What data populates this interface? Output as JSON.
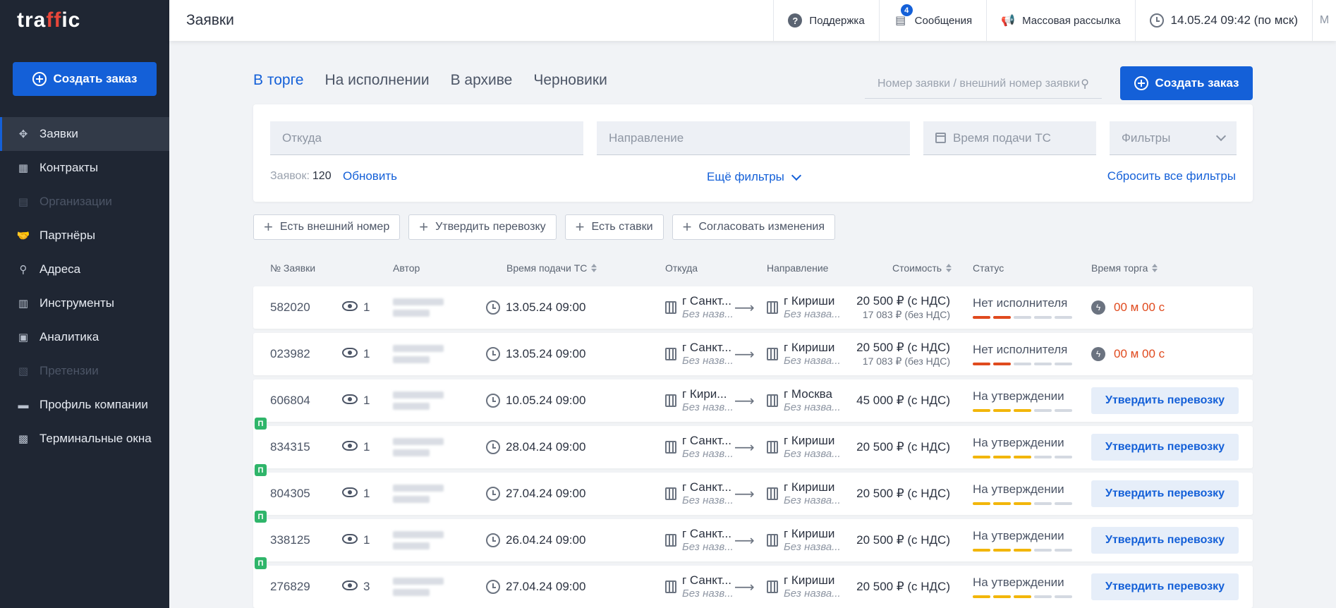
{
  "app": {
    "logo": "traffic"
  },
  "sidebar": {
    "create_label": "Создать заказ",
    "items": [
      {
        "label": "Заявки",
        "icon": "move-icon",
        "glyph": "✥",
        "active": true,
        "disabled": false
      },
      {
        "label": "Контракты",
        "icon": "calendar-icon",
        "glyph": "▦",
        "active": false,
        "disabled": false
      },
      {
        "label": "Организации",
        "icon": "building-icon",
        "glyph": "▤",
        "active": false,
        "disabled": true
      },
      {
        "label": "Партнёры",
        "icon": "handshake-icon",
        "glyph": "🤝",
        "active": false,
        "disabled": false
      },
      {
        "label": "Адреса",
        "icon": "pin-icon",
        "glyph": "⚲",
        "active": false,
        "disabled": false
      },
      {
        "label": "Инструменты",
        "icon": "tools-icon",
        "glyph": "▥",
        "active": false,
        "disabled": false
      },
      {
        "label": "Аналитика",
        "icon": "chart-icon",
        "glyph": "▣",
        "active": false,
        "disabled": false
      },
      {
        "label": "Претензии",
        "icon": "claim-icon",
        "glyph": "▧",
        "active": false,
        "disabled": true
      },
      {
        "label": "Профиль компании",
        "icon": "briefcase-icon",
        "glyph": "▬",
        "active": false,
        "disabled": false
      },
      {
        "label": "Терминальные окна",
        "icon": "lock-icon",
        "glyph": "▩",
        "active": false,
        "disabled": false
      }
    ]
  },
  "topbar": {
    "title": "Заявки",
    "support": "Поддержка",
    "messages": "Сообщения",
    "messages_badge": "4",
    "mailing": "Массовая рассылка",
    "datetime": "14.05.24 09:42 (по мск)",
    "user_initial": "М"
  },
  "tabs": [
    "В торге",
    "На исполнении",
    "В архиве",
    "Черновики"
  ],
  "search": {
    "placeholder": "Номер заявки / внешний номер заявки"
  },
  "create_label": "Создать заказ",
  "filters": {
    "from_placeholder": "Откуда",
    "direction_placeholder": "Направление",
    "time_placeholder": "Время подачи ТС",
    "filters_label": "Фильтры",
    "count_label": "Заявок:",
    "count": "120",
    "refresh": "Обновить",
    "more": "Ещё фильтры",
    "reset": "Сбросить все фильтры"
  },
  "chips": [
    "Есть внешний номер",
    "Утвердить перевозку",
    "Есть ставки",
    "Согласовать изменения"
  ],
  "columns": {
    "number": "№ Заявки",
    "author": "Автор",
    "time": "Время подачи ТС",
    "from": "Откуда",
    "direction": "Направление",
    "price": "Стоимость",
    "status": "Статус",
    "trade_time": "Время торга"
  },
  "colors": {
    "accent": "#1460d8",
    "danger": "#e04a1e",
    "warning": "#f2b60a",
    "badge": "#2fb56a"
  },
  "rows": [
    {
      "number": "582020",
      "views": "1",
      "time": "13.05.24 09:00",
      "from_city": "г Санкт...",
      "from_sub": "Без назв...",
      "to_city": "г Кириши",
      "to_sub": "Без назва...",
      "price": "20 500 ₽ (с НДС)",
      "price_net": "17 083 ₽ (без НДС)",
      "status": "Нет исполнителя",
      "status_level": 2,
      "status_color": "red",
      "trade": "timer",
      "trade_value": "00 м 00 с",
      "badge": ""
    },
    {
      "number": "023982",
      "views": "1",
      "time": "13.05.24 09:00",
      "from_city": "г Санкт...",
      "from_sub": "Без назв...",
      "to_city": "г Кириши",
      "to_sub": "Без назва...",
      "price": "20 500 ₽ (с НДС)",
      "price_net": "17 083 ₽ (без НДС)",
      "status": "Нет исполнителя",
      "status_level": 2,
      "status_color": "red",
      "trade": "timer",
      "trade_value": "00 м 00 с",
      "badge": ""
    },
    {
      "number": "606804",
      "views": "1",
      "time": "10.05.24 09:00",
      "from_city": "г Кири...",
      "from_sub": "Без назв...",
      "to_city": "г Москва",
      "to_sub": "Без назва...",
      "price": "45 000 ₽ (с НДС)",
      "price_net": "",
      "status": "На утверждении",
      "status_level": 3,
      "status_color": "yellow",
      "trade": "button",
      "trade_value": "Утвердить перевозку",
      "badge": ""
    },
    {
      "number": "834315",
      "views": "1",
      "time": "28.04.24 09:00",
      "from_city": "г Санкт...",
      "from_sub": "Без назв...",
      "to_city": "г Кириши",
      "to_sub": "Без назва...",
      "price": "20 500 ₽ (с НДС)",
      "price_net": "",
      "status": "На утверждении",
      "status_level": 3,
      "status_color": "yellow",
      "trade": "button",
      "trade_value": "Утвердить перевозку",
      "badge": "П"
    },
    {
      "number": "804305",
      "views": "1",
      "time": "27.04.24 09:00",
      "from_city": "г Санкт...",
      "from_sub": "Без назв...",
      "to_city": "г Кириши",
      "to_sub": "Без назва...",
      "price": "20 500 ₽ (с НДС)",
      "price_net": "",
      "status": "На утверждении",
      "status_level": 3,
      "status_color": "yellow",
      "trade": "button",
      "trade_value": "Утвердить перевозку",
      "badge": "П"
    },
    {
      "number": "338125",
      "views": "1",
      "time": "26.04.24 09:00",
      "from_city": "г Санкт...",
      "from_sub": "Без назв...",
      "to_city": "г Кириши",
      "to_sub": "Без назва...",
      "price": "20 500 ₽ (с НДС)",
      "price_net": "",
      "status": "На утверждении",
      "status_level": 3,
      "status_color": "yellow",
      "trade": "button",
      "trade_value": "Утвердить перевозку",
      "badge": "П"
    },
    {
      "number": "276829",
      "views": "3",
      "time": "27.04.24 09:00",
      "from_city": "г Санкт...",
      "from_sub": "Без назв...",
      "to_city": "г Кириши",
      "to_sub": "Без назва...",
      "price": "20 500 ₽ (с НДС)",
      "price_net": "",
      "status": "На утверждении",
      "status_level": 3,
      "status_color": "yellow",
      "trade": "button",
      "trade_value": "Утвердить перевозку",
      "badge": "П"
    }
  ]
}
